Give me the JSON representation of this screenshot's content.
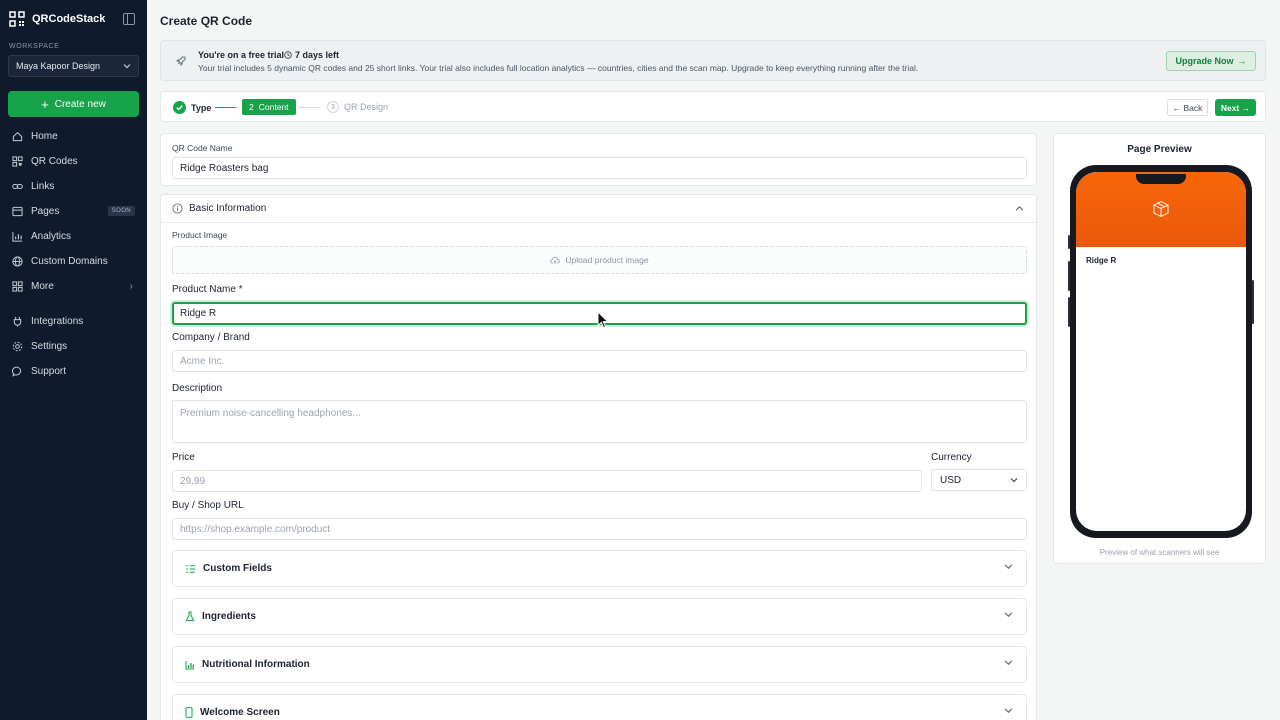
{
  "app": {
    "name": "QRCodeStack"
  },
  "sidebar": {
    "workspace_label": "WORKSPACE",
    "workspace_value": "Maya Kapoor Design",
    "create_label": "Create new",
    "items": [
      {
        "label": "Home",
        "icon": "home-icon"
      },
      {
        "label": "QR Codes",
        "icon": "qr-icon"
      },
      {
        "label": "Links",
        "icon": "link-icon"
      },
      {
        "label": "Pages",
        "icon": "pages-icon",
        "badge": "SOON"
      },
      {
        "label": "Analytics",
        "icon": "analytics-icon"
      },
      {
        "label": "Custom Domains",
        "icon": "globe-icon"
      },
      {
        "label": "More",
        "icon": "grid-icon"
      },
      {
        "label": "Integrations",
        "icon": "plug-icon"
      },
      {
        "label": "Settings",
        "icon": "gear-icon"
      },
      {
        "label": "Support",
        "icon": "chat-icon"
      }
    ]
  },
  "header": {
    "title": "Create QR Code"
  },
  "trial": {
    "title": "You're on a free trial",
    "days_left": "7 days left",
    "description": "Your trial includes 5 dynamic QR codes and 25 short links. Your trial also includes full location analytics — countries, cities and the scan map. Upgrade to keep everything running after the trial.",
    "upgrade_label": "Upgrade Now"
  },
  "stepper": {
    "step1": "Type",
    "step2_num": "2",
    "step2": "Content",
    "step3_num": "3",
    "step3": "QR Design",
    "back_label": "Back",
    "next_label": "Next"
  },
  "form": {
    "qr_name_label": "QR Code Name",
    "qr_name_value": "Ridge Roasters bag",
    "basic_title": "Basic Information",
    "product_image_label": "Product Image",
    "upload_label": "Upload product image",
    "product_name_label": "Product Name *",
    "product_name_value": "Ridge R",
    "company_label": "Company / Brand",
    "company_placeholder": "Acme Inc.",
    "description_label": "Description",
    "description_placeholder": "Premium noise-cancelling headphones...",
    "price_label": "Price",
    "price_placeholder": "29.99",
    "currency_label": "Currency",
    "currency_value": "USD",
    "url_label": "Buy / Shop URL",
    "url_placeholder": "https://shop.example.com/product",
    "sections": [
      "Custom Fields",
      "Ingredients",
      "Nutritional Information",
      "Welcome Screen"
    ]
  },
  "preview": {
    "title": "Page Preview",
    "product_name": "Ridge R",
    "caption": "Preview of what scanners will see"
  },
  "colors": {
    "accent": "#16a34a",
    "sidebar_bg": "#0f1b2d",
    "preview_hero": "#ea580c"
  }
}
